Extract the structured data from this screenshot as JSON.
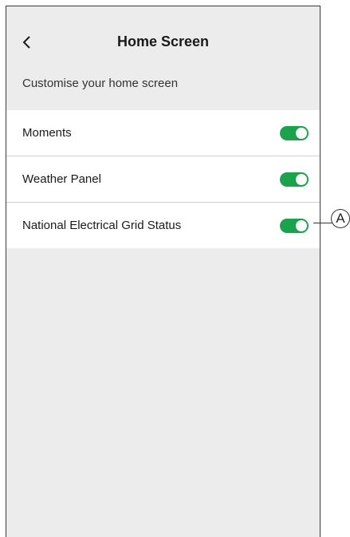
{
  "header": {
    "back_label": "<",
    "title": "Home Screen"
  },
  "subtitle": "Customise your home screen",
  "rows": [
    {
      "label": "Moments",
      "enabled": true
    },
    {
      "label": "Weather Panel",
      "enabled": true
    },
    {
      "label": "National Electrical Grid Status",
      "enabled": true
    }
  ],
  "callout": {
    "label": "A"
  },
  "colors": {
    "toggle_on": "#1aa34a",
    "background": "#ececec",
    "row_background": "#ffffff"
  },
  "icons": {
    "back": "chevron-left-icon"
  }
}
